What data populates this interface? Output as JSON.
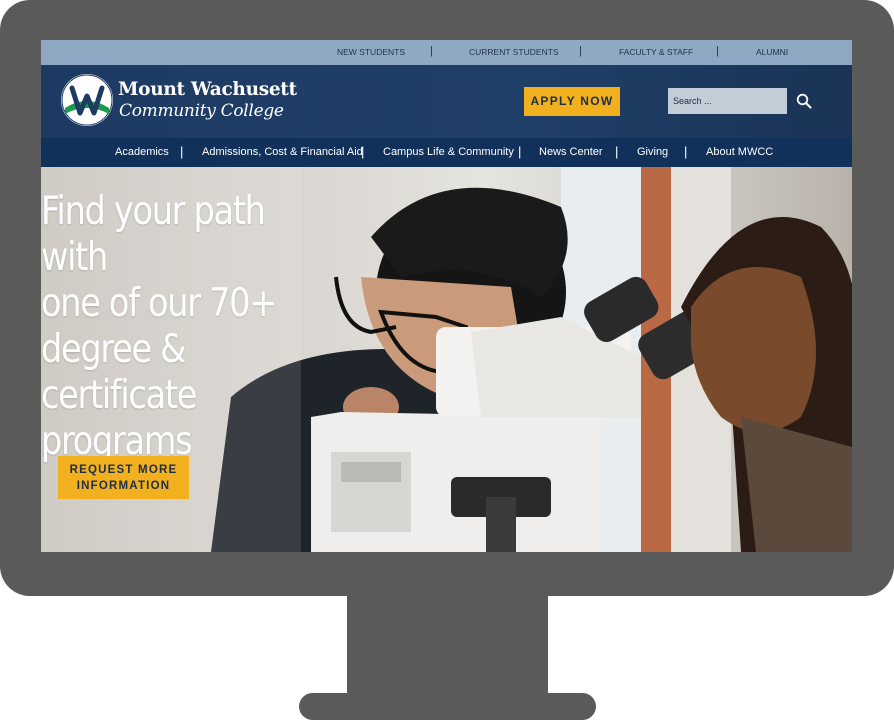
{
  "utility_nav": {
    "items": [
      "NEW STUDENTS",
      "CURRENT STUDENTS",
      "FACULTY & STAFF",
      "ALUMNI"
    ],
    "separator": "|"
  },
  "header": {
    "logo_line1": "Mount Wachusett",
    "logo_line2": "Community College",
    "apply_label": "APPLY NOW",
    "search_placeholder": "Search ..."
  },
  "main_nav": {
    "items": [
      "Academics",
      "Admissions, Cost & Financial Aid",
      "Campus Life & Community",
      "News Center",
      "Giving",
      "About MWCC"
    ],
    "separator": "|"
  },
  "hero": {
    "heading": "Find your path with\none of our 70+\ndegree &\ncertificate\nprograms",
    "cta_label": "REQUEST MORE\nINFORMATION"
  },
  "colors": {
    "accent_yellow": "#f2b01e",
    "header_navy": "#1d3a62",
    "utility_blue": "#8fa9c4",
    "frame_gray": "#5a5a5a",
    "logo_green": "#1a9a4a"
  },
  "icons": [
    "search-icon",
    "logo-w-icon"
  ]
}
